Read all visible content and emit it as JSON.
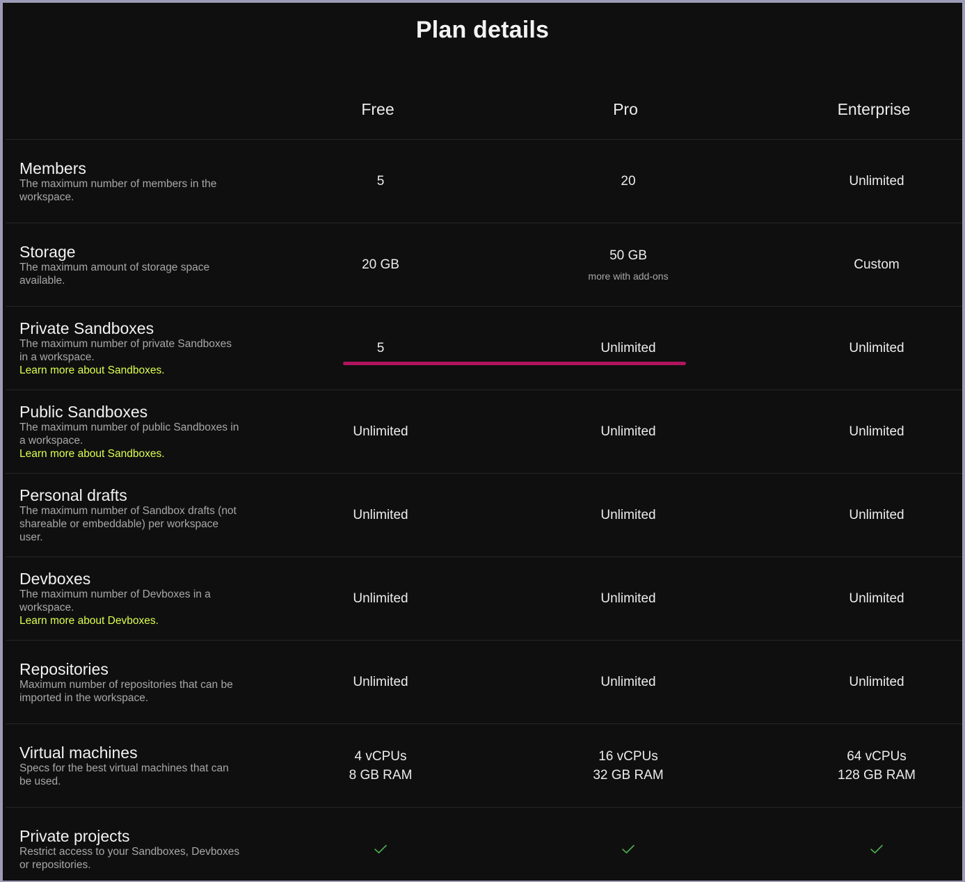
{
  "title": "Plan details",
  "plans": [
    "Free",
    "Pro",
    "Enterprise"
  ],
  "rows": [
    {
      "name": "Members",
      "description": "The maximum number of members in the workspace.",
      "values": [
        {
          "main": "5"
        },
        {
          "main": "20"
        },
        {
          "main": "Unlimited"
        }
      ]
    },
    {
      "name": "Storage",
      "description": "The maximum amount of storage space available.",
      "values": [
        {
          "main": "20 GB"
        },
        {
          "main": "50 GB",
          "sub": "more with add-ons"
        },
        {
          "main": "Custom"
        }
      ]
    },
    {
      "name": "Private Sandboxes",
      "description": "The maximum number of private Sandboxes in a workspace.",
      "link": "Learn more about Sandboxes.",
      "values": [
        {
          "main": "5"
        },
        {
          "main": "Unlimited"
        },
        {
          "main": "Unlimited"
        }
      ]
    },
    {
      "name": "Public Sandboxes",
      "description": "The maximum number of public Sandboxes in a workspace.",
      "link": "Learn more about Sandboxes.",
      "values": [
        {
          "main": "Unlimited"
        },
        {
          "main": "Unlimited"
        },
        {
          "main": "Unlimited"
        }
      ]
    },
    {
      "name": "Personal drafts",
      "description": "The maximum number of Sandbox drafts (not shareable or embeddable) per workspace user.",
      "values": [
        {
          "main": "Unlimited"
        },
        {
          "main": "Unlimited"
        },
        {
          "main": "Unlimited"
        }
      ]
    },
    {
      "name": "Devboxes",
      "description": "The maximum number of Devboxes in a workspace.",
      "link": "Learn more about Devboxes.",
      "values": [
        {
          "main": "Unlimited"
        },
        {
          "main": "Unlimited"
        },
        {
          "main": "Unlimited"
        }
      ]
    },
    {
      "name": "Repositories",
      "description": "Maximum number of repositories that can be imported in the workspace.",
      "values": [
        {
          "main": "Unlimited"
        },
        {
          "main": "Unlimited"
        },
        {
          "main": "Unlimited"
        }
      ]
    },
    {
      "name": "Virtual machines",
      "description": "Specs for the best virtual machines that can be used.",
      "values": [
        {
          "main": "4 vCPUs",
          "line2": "8 GB RAM"
        },
        {
          "main": "16 vCPUs",
          "line2": "32 GB RAM"
        },
        {
          "main": "64 vCPUs",
          "line2": "128 GB RAM"
        }
      ]
    },
    {
      "name": "Private projects",
      "description": "Restrict access to your Sandboxes, Devboxes or repositories.",
      "values": [
        {
          "check": true
        },
        {
          "check": true
        },
        {
          "check": true
        }
      ]
    }
  ],
  "colors": {
    "background": "#0f0f0f",
    "link": "#dcff50",
    "check": "#4caf50",
    "highlight": "#b0145e"
  },
  "icons": {
    "included": "checkmark-icon"
  }
}
